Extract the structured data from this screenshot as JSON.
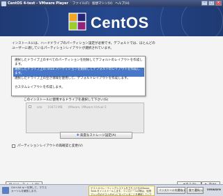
{
  "window": {
    "title": "CentOS 4-test - VMware Player",
    "menus": [
      "ファイル(F)",
      "仮想マシン(V)",
      "ヘルプ(H)"
    ]
  },
  "header": {
    "logo_text": "CentOS"
  },
  "installer": {
    "intro": "インストールには、ハードドライブのパーティション設定が必要です。デフォルトでは、ほとんどのユーザーに適しているパーティションレイアウトが選択されています。",
    "dropdown_options": [
      "選択したドライブ上のすべてのパーティションを削除してデフォルトのレイアウトを作成します。",
      "選択したドライブ上の linux パーティションを削除してデフォルトのレイアウトを作成します。",
      "選択したドライブ上の空き領域を使用して、デフォルトレイアウトを作成します。",
      "カスタムレイアウトを作成します。"
    ],
    "selected_index": 1,
    "drive_label": "このインストールに使用するドライブを選択して下さい(S)",
    "drive_row": {
      "device": "sda",
      "size": "10473 MB",
      "model": "VMware, VMware Virtual S"
    },
    "advanced_button": "高度なストレージ設定(A)",
    "review_checkbox": "パーティションレイアウトの再確認と変更(V)",
    "release_notes": "リリースノート(R)",
    "back_button": "戻る(B)",
    "next_button": "次(N)"
  },
  "statusbar": {
    "hint": "Ctrl+Alt キーを押して、マウスカーソルを解放します。",
    "notice": "ゲストオペレーティングシステムを立ち上げるVMware Tools をインストールします。インストールの際は、仮想マシン内のゲストがオンになっていることを確認してください。",
    "install_button": "インストールを開始(I)",
    "later_button": "後で通知(L)",
    "brand": "vmware"
  }
}
